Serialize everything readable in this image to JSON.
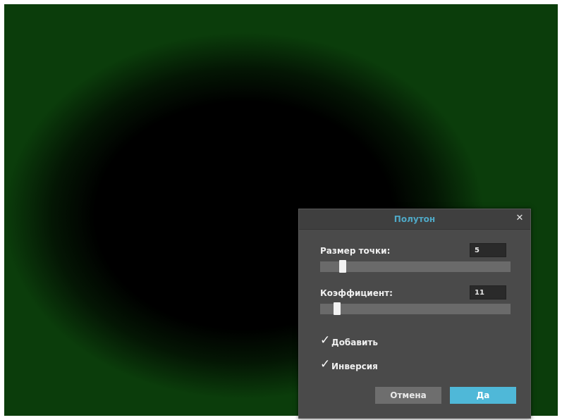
{
  "dialog": {
    "title": "Полутон",
    "close_icon": "close-icon",
    "dot_size": {
      "label": "Размер точки:",
      "value": "5",
      "slider_fraction": 0.1
    },
    "coefficient": {
      "label": "Коэффициент:",
      "value": "11",
      "slider_fraction": 0.07
    },
    "checkboxes": [
      {
        "label": "Добавить",
        "checked": true
      },
      {
        "label": "Инверсия",
        "checked": true
      }
    ],
    "cancel_label": "Отмена",
    "ok_label": "Да"
  },
  "colors": {
    "accent": "#4fb8d8",
    "title": "#4fa9c7",
    "dialog_bg": "#4a4a4a"
  }
}
